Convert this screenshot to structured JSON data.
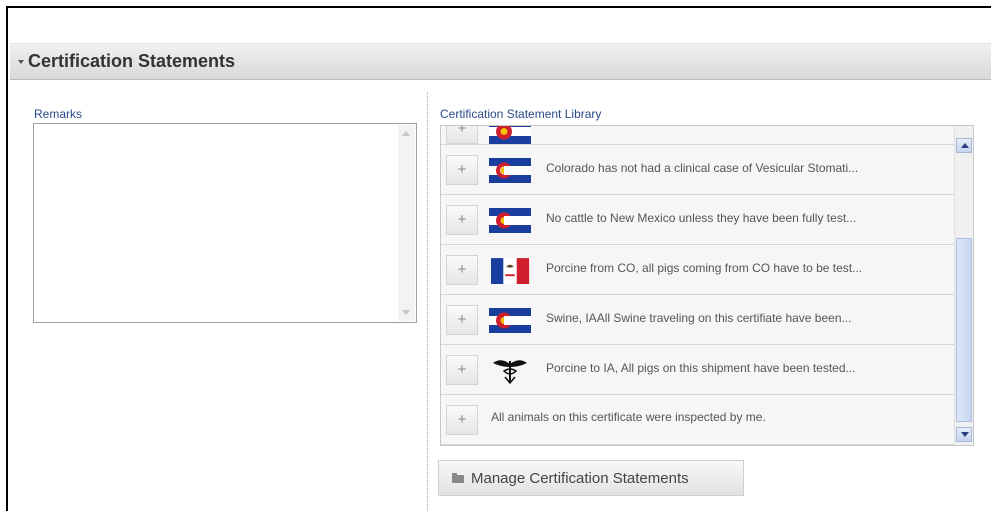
{
  "section": {
    "title": "Certification Statements"
  },
  "remarks": {
    "label": "Remarks",
    "value": ""
  },
  "library": {
    "label": "Certification Statement Library",
    "items": [
      {
        "text": "",
        "icon": "colorado-flag-icon"
      },
      {
        "text": "Colorado has not had a clinical case of Vesicular Stomati...",
        "icon": "colorado-flag-icon"
      },
      {
        "text": "No cattle to New Mexico unless they have been fully test...",
        "icon": "colorado-flag-icon"
      },
      {
        "text": "Porcine from CO, all pigs coming from CO have to be test...",
        "icon": "iowa-flag-icon"
      },
      {
        "text": "Swine, IAAll Swine traveling on this certifiate have been...",
        "icon": "colorado-flag-icon"
      },
      {
        "text": "Porcine to IA, All pigs on this shipment have been tested...",
        "icon": "veterinary-emblem-icon"
      },
      {
        "text": "All animals on this certificate were inspected by me.",
        "icon": ""
      }
    ],
    "add_label": "+"
  },
  "manage_button": {
    "label": "Manage Certification Statements",
    "icon": "folder-icon"
  }
}
